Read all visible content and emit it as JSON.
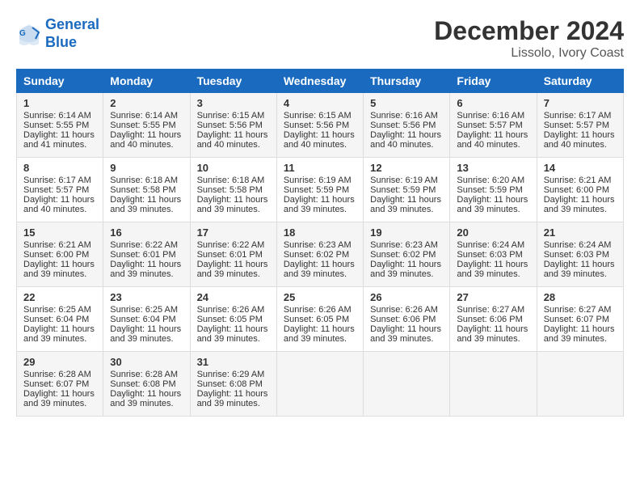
{
  "logo": {
    "line1": "General",
    "line2": "Blue"
  },
  "title": "December 2024",
  "subtitle": "Lissolo, Ivory Coast",
  "weekdays": [
    "Sunday",
    "Monday",
    "Tuesday",
    "Wednesday",
    "Thursday",
    "Friday",
    "Saturday"
  ],
  "weeks": [
    [
      {
        "day": "1",
        "sunrise": "Sunrise: 6:14 AM",
        "sunset": "Sunset: 5:55 PM",
        "daylight": "Daylight: 11 hours and 41 minutes."
      },
      {
        "day": "2",
        "sunrise": "Sunrise: 6:14 AM",
        "sunset": "Sunset: 5:55 PM",
        "daylight": "Daylight: 11 hours and 40 minutes."
      },
      {
        "day": "3",
        "sunrise": "Sunrise: 6:15 AM",
        "sunset": "Sunset: 5:56 PM",
        "daylight": "Daylight: 11 hours and 40 minutes."
      },
      {
        "day": "4",
        "sunrise": "Sunrise: 6:15 AM",
        "sunset": "Sunset: 5:56 PM",
        "daylight": "Daylight: 11 hours and 40 minutes."
      },
      {
        "day": "5",
        "sunrise": "Sunrise: 6:16 AM",
        "sunset": "Sunset: 5:56 PM",
        "daylight": "Daylight: 11 hours and 40 minutes."
      },
      {
        "day": "6",
        "sunrise": "Sunrise: 6:16 AM",
        "sunset": "Sunset: 5:57 PM",
        "daylight": "Daylight: 11 hours and 40 minutes."
      },
      {
        "day": "7",
        "sunrise": "Sunrise: 6:17 AM",
        "sunset": "Sunset: 5:57 PM",
        "daylight": "Daylight: 11 hours and 40 minutes."
      }
    ],
    [
      {
        "day": "8",
        "sunrise": "Sunrise: 6:17 AM",
        "sunset": "Sunset: 5:57 PM",
        "daylight": "Daylight: 11 hours and 40 minutes."
      },
      {
        "day": "9",
        "sunrise": "Sunrise: 6:18 AM",
        "sunset": "Sunset: 5:58 PM",
        "daylight": "Daylight: 11 hours and 39 minutes."
      },
      {
        "day": "10",
        "sunrise": "Sunrise: 6:18 AM",
        "sunset": "Sunset: 5:58 PM",
        "daylight": "Daylight: 11 hours and 39 minutes."
      },
      {
        "day": "11",
        "sunrise": "Sunrise: 6:19 AM",
        "sunset": "Sunset: 5:59 PM",
        "daylight": "Daylight: 11 hours and 39 minutes."
      },
      {
        "day": "12",
        "sunrise": "Sunrise: 6:19 AM",
        "sunset": "Sunset: 5:59 PM",
        "daylight": "Daylight: 11 hours and 39 minutes."
      },
      {
        "day": "13",
        "sunrise": "Sunrise: 6:20 AM",
        "sunset": "Sunset: 5:59 PM",
        "daylight": "Daylight: 11 hours and 39 minutes."
      },
      {
        "day": "14",
        "sunrise": "Sunrise: 6:21 AM",
        "sunset": "Sunset: 6:00 PM",
        "daylight": "Daylight: 11 hours and 39 minutes."
      }
    ],
    [
      {
        "day": "15",
        "sunrise": "Sunrise: 6:21 AM",
        "sunset": "Sunset: 6:00 PM",
        "daylight": "Daylight: 11 hours and 39 minutes."
      },
      {
        "day": "16",
        "sunrise": "Sunrise: 6:22 AM",
        "sunset": "Sunset: 6:01 PM",
        "daylight": "Daylight: 11 hours and 39 minutes."
      },
      {
        "day": "17",
        "sunrise": "Sunrise: 6:22 AM",
        "sunset": "Sunset: 6:01 PM",
        "daylight": "Daylight: 11 hours and 39 minutes."
      },
      {
        "day": "18",
        "sunrise": "Sunrise: 6:23 AM",
        "sunset": "Sunset: 6:02 PM",
        "daylight": "Daylight: 11 hours and 39 minutes."
      },
      {
        "day": "19",
        "sunrise": "Sunrise: 6:23 AM",
        "sunset": "Sunset: 6:02 PM",
        "daylight": "Daylight: 11 hours and 39 minutes."
      },
      {
        "day": "20",
        "sunrise": "Sunrise: 6:24 AM",
        "sunset": "Sunset: 6:03 PM",
        "daylight": "Daylight: 11 hours and 39 minutes."
      },
      {
        "day": "21",
        "sunrise": "Sunrise: 6:24 AM",
        "sunset": "Sunset: 6:03 PM",
        "daylight": "Daylight: 11 hours and 39 minutes."
      }
    ],
    [
      {
        "day": "22",
        "sunrise": "Sunrise: 6:25 AM",
        "sunset": "Sunset: 6:04 PM",
        "daylight": "Daylight: 11 hours and 39 minutes."
      },
      {
        "day": "23",
        "sunrise": "Sunrise: 6:25 AM",
        "sunset": "Sunset: 6:04 PM",
        "daylight": "Daylight: 11 hours and 39 minutes."
      },
      {
        "day": "24",
        "sunrise": "Sunrise: 6:26 AM",
        "sunset": "Sunset: 6:05 PM",
        "daylight": "Daylight: 11 hours and 39 minutes."
      },
      {
        "day": "25",
        "sunrise": "Sunrise: 6:26 AM",
        "sunset": "Sunset: 6:05 PM",
        "daylight": "Daylight: 11 hours and 39 minutes."
      },
      {
        "day": "26",
        "sunrise": "Sunrise: 6:26 AM",
        "sunset": "Sunset: 6:06 PM",
        "daylight": "Daylight: 11 hours and 39 minutes."
      },
      {
        "day": "27",
        "sunrise": "Sunrise: 6:27 AM",
        "sunset": "Sunset: 6:06 PM",
        "daylight": "Daylight: 11 hours and 39 minutes."
      },
      {
        "day": "28",
        "sunrise": "Sunrise: 6:27 AM",
        "sunset": "Sunset: 6:07 PM",
        "daylight": "Daylight: 11 hours and 39 minutes."
      }
    ],
    [
      {
        "day": "29",
        "sunrise": "Sunrise: 6:28 AM",
        "sunset": "Sunset: 6:07 PM",
        "daylight": "Daylight: 11 hours and 39 minutes."
      },
      {
        "day": "30",
        "sunrise": "Sunrise: 6:28 AM",
        "sunset": "Sunset: 6:08 PM",
        "daylight": "Daylight: 11 hours and 39 minutes."
      },
      {
        "day": "31",
        "sunrise": "Sunrise: 6:29 AM",
        "sunset": "Sunset: 6:08 PM",
        "daylight": "Daylight: 11 hours and 39 minutes."
      },
      null,
      null,
      null,
      null
    ]
  ]
}
